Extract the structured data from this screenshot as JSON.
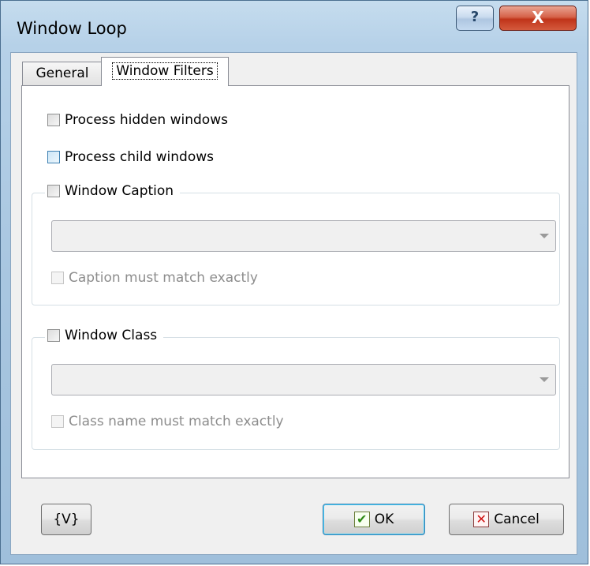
{
  "window": {
    "title": "Window Loop",
    "help_button": "?",
    "close_button": "X"
  },
  "tabs": [
    {
      "label": "General",
      "selected": false
    },
    {
      "label": "Window Filters",
      "selected": true
    }
  ],
  "filters": {
    "process_hidden": {
      "label": "Process hidden windows",
      "checked": false
    },
    "process_child": {
      "label": "Process child windows",
      "checked": false
    },
    "caption_group": {
      "label": "Window Caption",
      "checked": false,
      "combo_value": "",
      "match_exactly": {
        "label": "Caption must match exactly",
        "checked": false,
        "enabled": false
      }
    },
    "class_group": {
      "label": "Window Class",
      "checked": false,
      "combo_value": "",
      "match_exactly": {
        "label": "Class name must match exactly",
        "checked": false,
        "enabled": false
      }
    }
  },
  "buttons": {
    "variables_label": "{V}",
    "ok_label": "OK",
    "cancel_label": "Cancel"
  },
  "icons": {
    "ok": "check-icon",
    "cancel": "x-icon",
    "combo": "chevron-down-icon"
  }
}
